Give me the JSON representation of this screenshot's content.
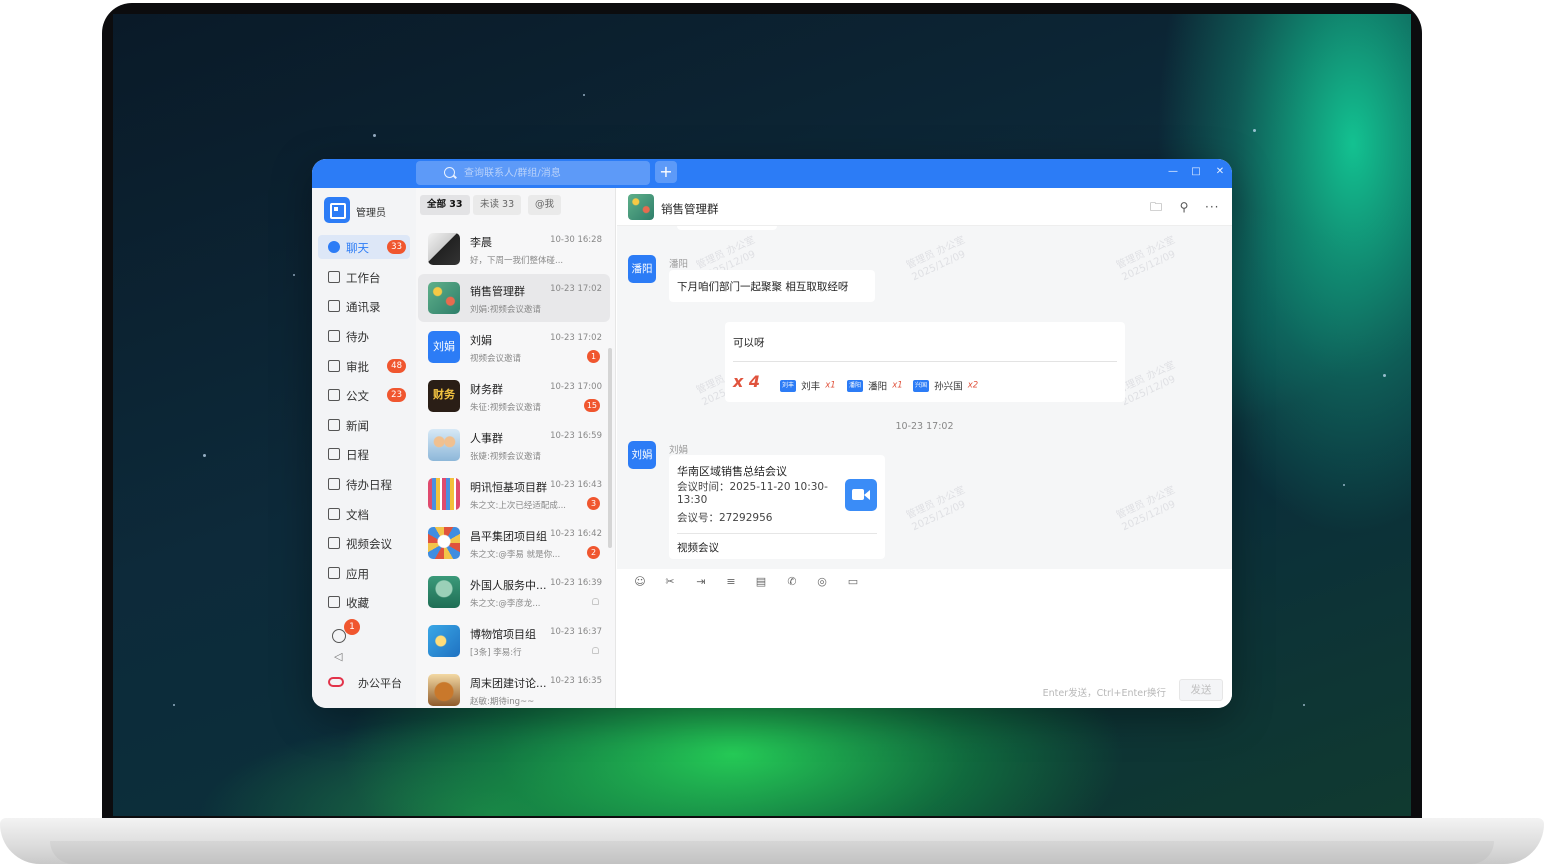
{
  "search": {
    "placeholder": "查询联系人/群组/消息"
  },
  "titlebar": {
    "add_label": "+",
    "minimize": "—",
    "maximize": "□",
    "close": "✕"
  },
  "user": {
    "name": "管理员"
  },
  "sidebar": {
    "items": [
      {
        "label": "聊天",
        "badge": "33",
        "icon": "chat-icon",
        "active": true
      },
      {
        "label": "工作台",
        "badge": "",
        "icon": "workbench-icon"
      },
      {
        "label": "通讯录",
        "badge": "",
        "icon": "contacts-icon"
      },
      {
        "label": "待办",
        "badge": "",
        "icon": "todo-icon"
      },
      {
        "label": "审批",
        "badge": "48",
        "icon": "approval-icon"
      },
      {
        "label": "公文",
        "badge": "23",
        "icon": "document-icon"
      },
      {
        "label": "新闻",
        "badge": "",
        "icon": "news-icon"
      },
      {
        "label": "日程",
        "badge": "",
        "icon": "calendar-icon"
      },
      {
        "label": "待办日程",
        "badge": "",
        "icon": "todo-calendar-icon"
      },
      {
        "label": "文档",
        "badge": "",
        "icon": "docs-icon"
      },
      {
        "label": "视频会议",
        "badge": "",
        "icon": "video-meeting-icon"
      },
      {
        "label": "应用",
        "badge": "",
        "icon": "apps-icon"
      },
      {
        "label": "收藏",
        "badge": "",
        "icon": "favorites-icon"
      }
    ],
    "extra_badge": "1",
    "collapse": "◁",
    "platform_label": "办公平台"
  },
  "filters": [
    {
      "label": "全部 33",
      "active": true
    },
    {
      "label": "未读 33"
    },
    {
      "label": "@我"
    }
  ],
  "conversations": [
    {
      "name": "李晨",
      "time": "10-30 16:28",
      "preview": "好，下周一我们整体碰...",
      "badge": "",
      "avatar_text": ""
    },
    {
      "name": "销售管理群",
      "time": "10-23 17:02",
      "preview": "刘娟:视频会议邀请",
      "badge": "",
      "avatar_text": ""
    },
    {
      "name": "刘娟",
      "time": "10-23 17:02",
      "preview": "视频会议邀请",
      "badge": "1",
      "avatar_text": "刘娟"
    },
    {
      "name": "财务群",
      "time": "10-23 17:00",
      "preview": "朱征:视频会议邀请",
      "badge": "15",
      "avatar_text": "财务"
    },
    {
      "name": "人事群",
      "time": "10-23 16:59",
      "preview": "张婕:视频会议邀请",
      "badge": "",
      "avatar_text": ""
    },
    {
      "name": "明讯恒基项目群",
      "time": "10-23 16:43",
      "preview": "朱之文:上次已经适配成...",
      "badge": "3",
      "avatar_text": ""
    },
    {
      "name": "昌平集团项目组",
      "time": "10-23 16:42",
      "preview": "朱之文:@李易 就是你...",
      "badge": "2",
      "avatar_text": ""
    },
    {
      "name": "外国人服务中...",
      "time": "10-23 16:39",
      "preview": "朱之文:@李彦龙...",
      "badge": "",
      "avatar_text": ""
    },
    {
      "name": "博物馆项目组",
      "time": "10-23 16:37",
      "preview": "[3条] 李易:行",
      "badge": "",
      "avatar_text": ""
    },
    {
      "name": "周末团建讨论...",
      "time": "10-23 16:35",
      "preview": "赵敏:期待ing~~",
      "badge": "",
      "avatar_text": ""
    }
  ],
  "chat": {
    "title": "销售管理群",
    "watermark_line1": "管理员 办公室",
    "watermark_line2": "2025/12/09",
    "msg1": {
      "avatar": "潘阳",
      "sender": "潘阳",
      "text": "下月咱们部门一起聚聚 相互取取经呀"
    },
    "reaction": {
      "text": "可以呀",
      "total": "x 4",
      "users": [
        {
          "avatar": "刘丰",
          "name": "刘丰",
          "count": "x1"
        },
        {
          "avatar": "潘阳",
          "name": "潘阳",
          "count": "x1"
        },
        {
          "avatar": "兴国",
          "name": "孙兴国",
          "count": "x2"
        }
      ]
    },
    "timestamp": "10-23 17:02",
    "msg2": {
      "avatar": "刘娟",
      "sender": "刘娟",
      "meeting_title": "华南区域销售总结会议",
      "meeting_time_1": "会议时间：2025-11-20 10:30-",
      "meeting_time_2": "13:30",
      "meeting_id": "会议号：27292956",
      "footer": "视频会议"
    }
  },
  "composer": {
    "hint": "Enter发送，Ctrl+Enter换行",
    "send_label": "发送"
  },
  "colors": {
    "accent": "#2c7cf6",
    "badge": "#f0562f"
  }
}
